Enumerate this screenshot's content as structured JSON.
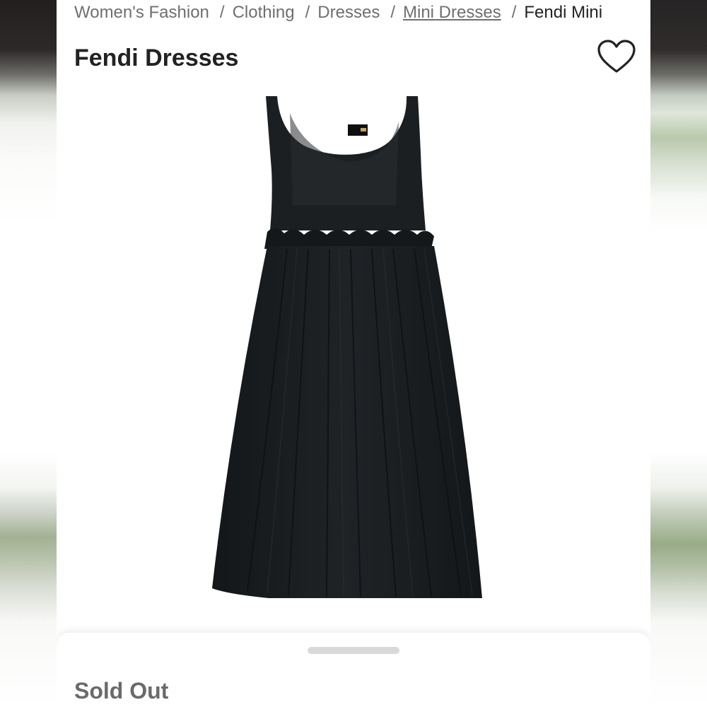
{
  "breadcrumb": {
    "items": [
      {
        "label": "Women's Fashion"
      },
      {
        "label": "Clothing"
      },
      {
        "label": "Dresses"
      },
      {
        "label": "Mini Dresses"
      },
      {
        "label": "Fendi Mini"
      }
    ],
    "separator": "/"
  },
  "product": {
    "brand": "Fendi",
    "category": "Dresses",
    "image_alt": "black sleeveless pleated mini dress",
    "favorite_icon": "heart-icon"
  },
  "status": {
    "label": "Sold Out"
  },
  "colors": {
    "text_primary": "#222222",
    "text_secondary": "#6f6f6f",
    "dress": "#1b1e21"
  }
}
